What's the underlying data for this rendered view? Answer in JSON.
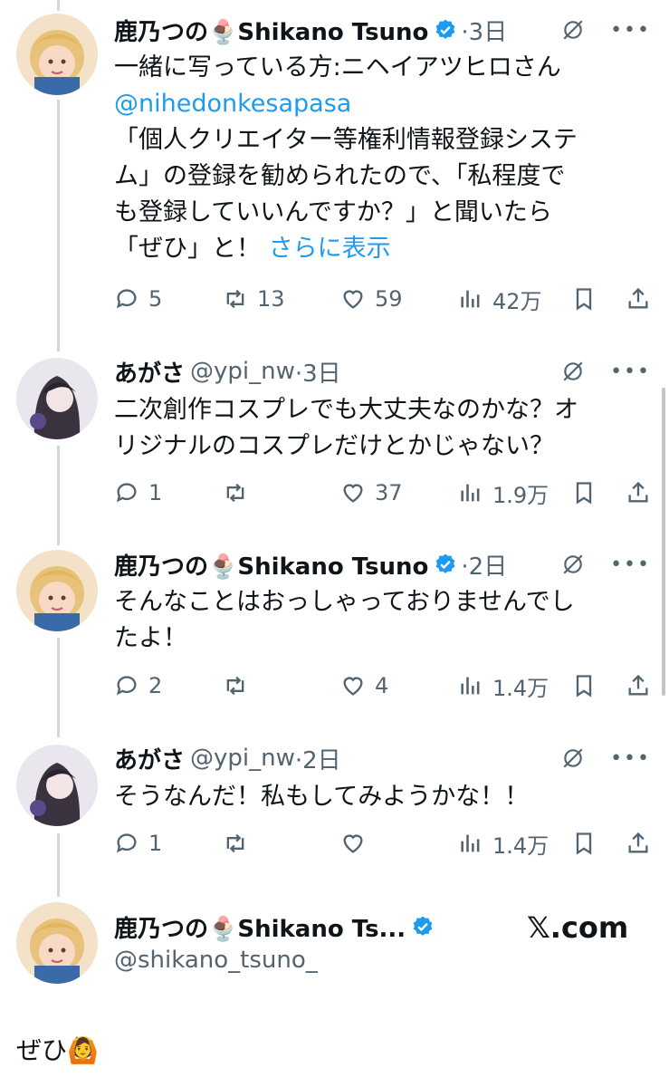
{
  "tweets": [
    {
      "name": "鹿乃つの🍨Shikano Tsuno",
      "handle": "",
      "time": "·3日",
      "lines": [
        "一緒に写っている方:ニヘイアツヒロさん"
      ],
      "mention": "@nihedonkesapasa",
      "lines2": [
        "「個人クリエイター等権利情報登録システ",
        "ム」の登録を勧められたので、「私程度で",
        "も登録していいんですか？」と聞いたら"
      ],
      "last_line": "「ぜひ」と！",
      "more_link": "さらに表示",
      "replies": "5",
      "retweets": "13",
      "likes": "59",
      "views": "42万"
    },
    {
      "name": "あがさ",
      "handle": "@ypi_nw",
      "time": "·3日",
      "lines": [
        "二次創作コスプレでも大丈夫なのかな？オ",
        "リジナルのコスプレだけとかじゃない？"
      ],
      "replies": "1",
      "retweets": "",
      "likes": "37",
      "views": "1.9万"
    },
    {
      "name": "鹿乃つの🍨Shikano Tsuno",
      "handle": "",
      "time": "·2日",
      "lines": [
        "そんなことはおっしゃっておりませんでし",
        "たよ！"
      ],
      "replies": "2",
      "retweets": "",
      "likes": "4",
      "views": "1.4万"
    },
    {
      "name": "あがさ",
      "handle": "@ypi_nw",
      "time": "·2日",
      "lines": [
        "そうなんだ！私もしてみようかな！！"
      ],
      "replies": "1",
      "retweets": "",
      "likes": "",
      "views": "1.4万"
    }
  ],
  "profile": {
    "name": "鹿乃つの🍨Shikano Ts...",
    "handle": "@shikano_tsuno_",
    "site": "𝕏.com"
  },
  "bottom_text": "ぜひ🙆",
  "colors": {
    "link": "#1d9bf0",
    "muted": "#536471",
    "text": "#0f1419",
    "line": "#cfd9de"
  }
}
